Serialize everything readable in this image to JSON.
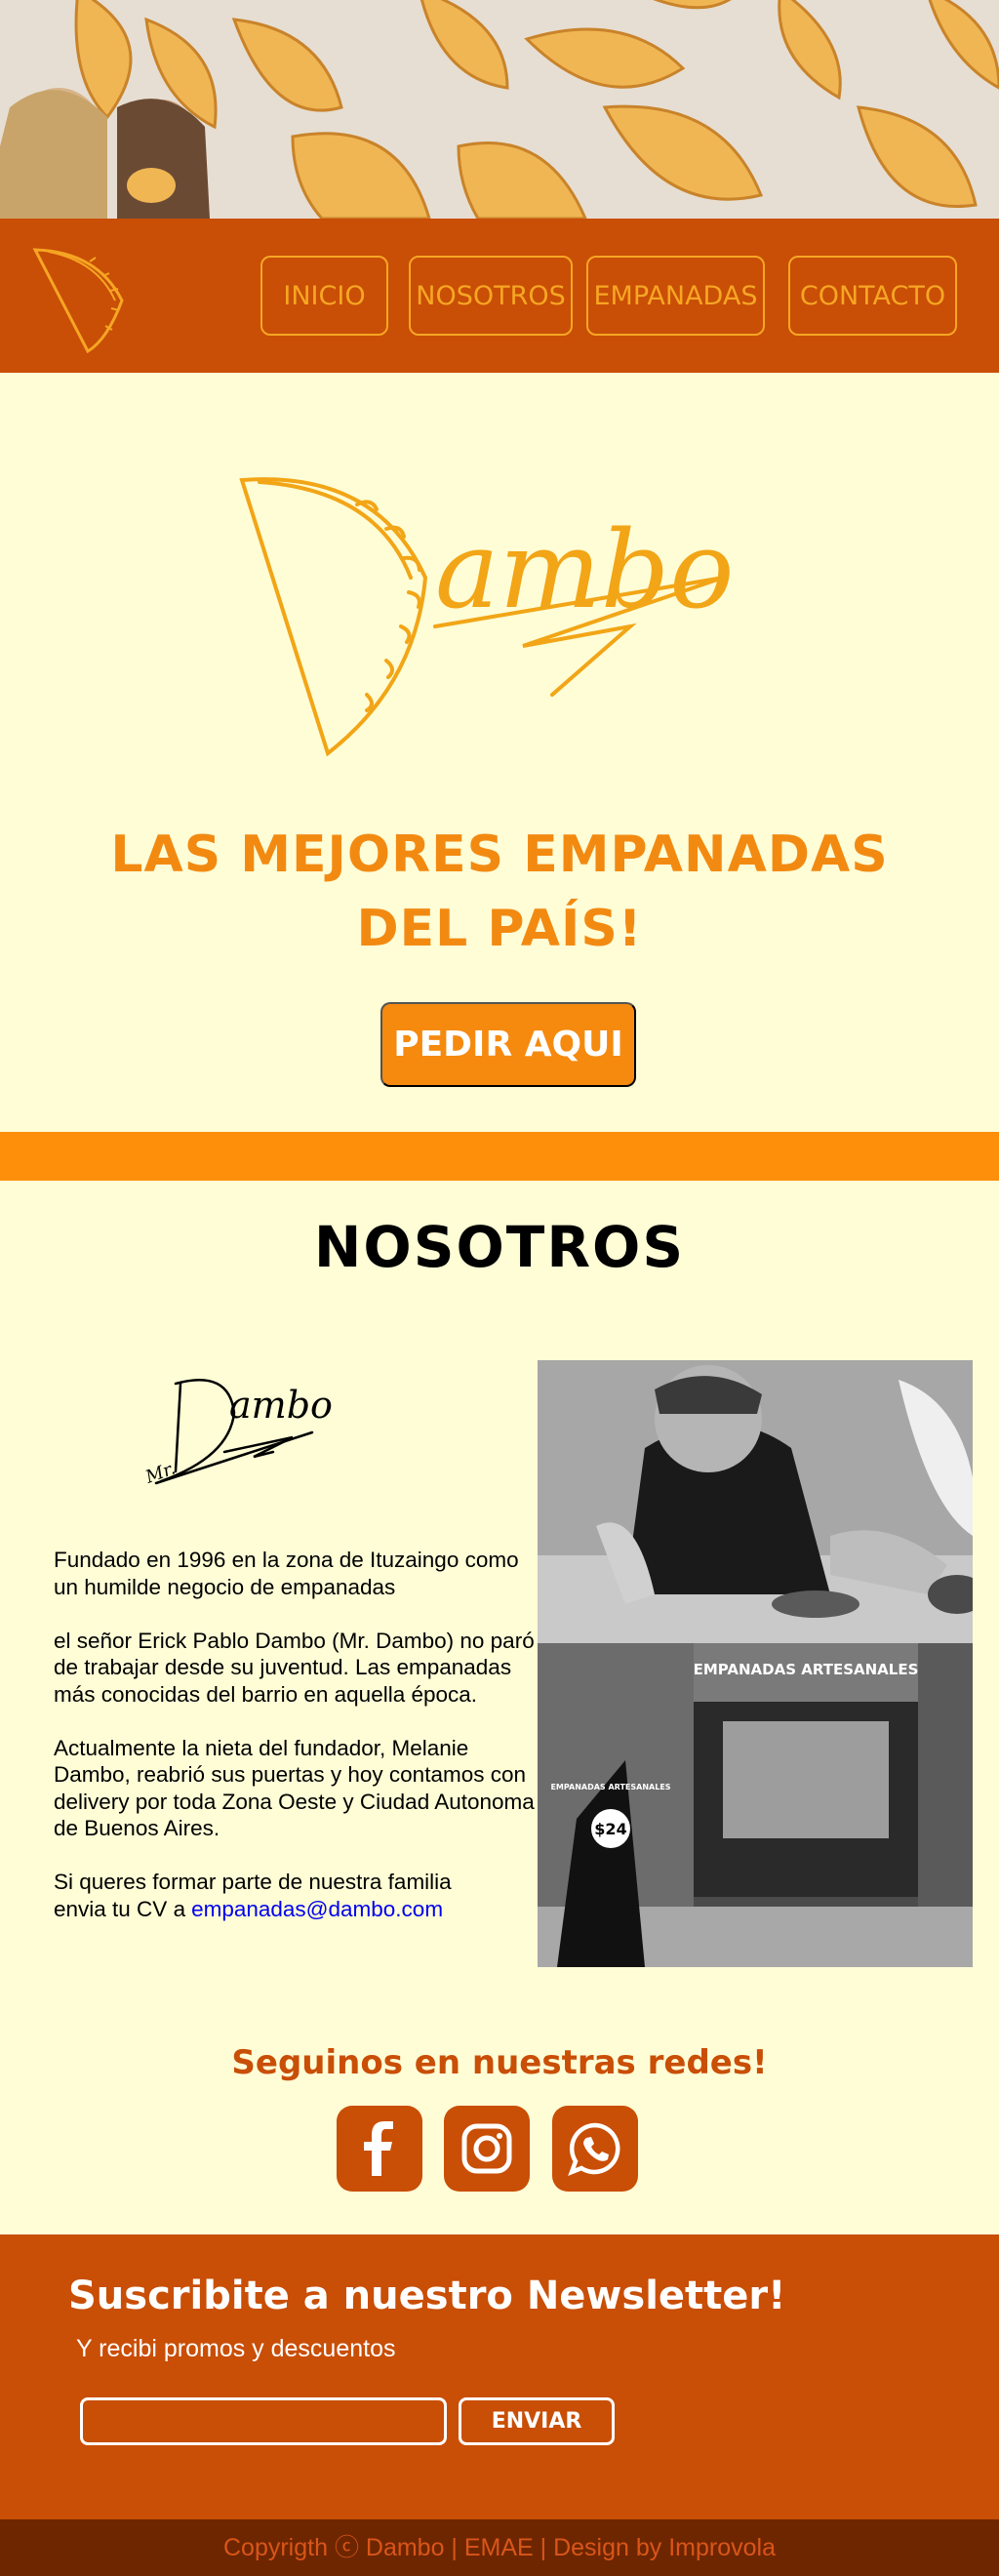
{
  "nav": {
    "items": [
      {
        "label": "INICIO"
      },
      {
        "label": "NOSOTROS"
      },
      {
        "label": "EMPANADAS"
      },
      {
        "label": "CONTACTO"
      }
    ]
  },
  "hero": {
    "slogan_line1": "LAS MEJORES EMPANADAS",
    "slogan_line2": "DEL PAÍS!",
    "cta_label": "PEDIR AQUI"
  },
  "brand": {
    "logo_text": "ambo",
    "signature_text": "ambo",
    "signature_prefix": "Mr."
  },
  "about": {
    "title": "NOSOTROS",
    "paragraphs": [
      "Fundado en 1996 en la zona de Ituzaingo como un humilde negocio de empanadas",
      "el señor Erick Pablo Dambo (Mr. Dambo) no paró de trabajar desde su juventud. Las empanadas más conocidas del barrio en aquella época.",
      "Actualmente la nieta del fundador, Melanie Dambo, reabrió sus puertas y hoy contamos con delivery por toda Zona Oeste y Ciudad Autonoma de Buenos Aires."
    ],
    "cv_line1": "Si queres formar parte de nuestra familia",
    "cv_line2": "envia tu CV a",
    "email": "empanadas@dambo.com",
    "store_sign": "EMPANADAS ARTESANALES",
    "store_board": "EMPANADAS ARTESANALES",
    "store_price": "$24"
  },
  "social": {
    "title": "Seguinos en nuestras redes!",
    "icons": [
      "facebook-icon",
      "instagram-icon",
      "whatsapp-icon"
    ]
  },
  "newsletter": {
    "title": "Suscribite a nuestro Newsletter!",
    "subtitle": "Y recibi promos y descuentos",
    "input_value": "",
    "button_label": "ENVIAR"
  },
  "footer": {
    "text": "Copyrigth ⓒ Dambo | EMAE | Design by Improvola"
  },
  "colors": {
    "navbar": "#c94e06",
    "accent": "#f28a12",
    "band": "#fd8f0b",
    "background": "#fefdd6",
    "footer": "#6e2600"
  }
}
